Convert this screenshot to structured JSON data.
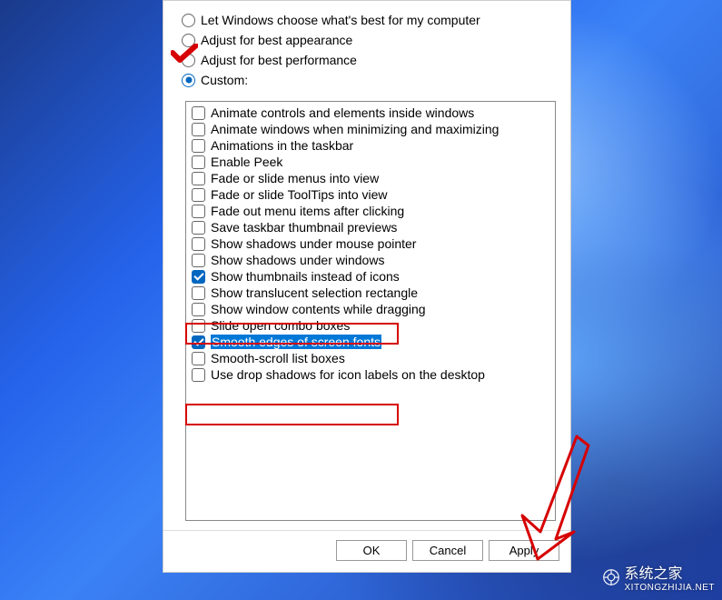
{
  "radios": {
    "r1": "Let Windows choose what's best for my computer",
    "r2": "Adjust for best appearance",
    "r3": "Adjust for best performance",
    "r4": "Custom:"
  },
  "options": {
    "o0": "Animate controls and elements inside windows",
    "o1": "Animate windows when minimizing and maximizing",
    "o2": "Animations in the taskbar",
    "o3": "Enable Peek",
    "o4": "Fade or slide menus into view",
    "o5": "Fade or slide ToolTips into view",
    "o6": "Fade out menu items after clicking",
    "o7": "Save taskbar thumbnail previews",
    "o8": "Show shadows under mouse pointer",
    "o9": "Show shadows under windows",
    "o10": "Show thumbnails instead of icons",
    "o11": "Show translucent selection rectangle",
    "o12": "Show window contents while dragging",
    "o13": "Slide open combo boxes",
    "o14": "Smooth edges of screen fonts",
    "o15": "Smooth-scroll list boxes",
    "o16": "Use drop shadows for icon labels on the desktop"
  },
  "buttons": {
    "ok": "OK",
    "cancel": "Cancel",
    "apply": "Apply"
  },
  "watermark": {
    "text": "系统之家",
    "url": "XITONGZHIJIA.NET"
  }
}
